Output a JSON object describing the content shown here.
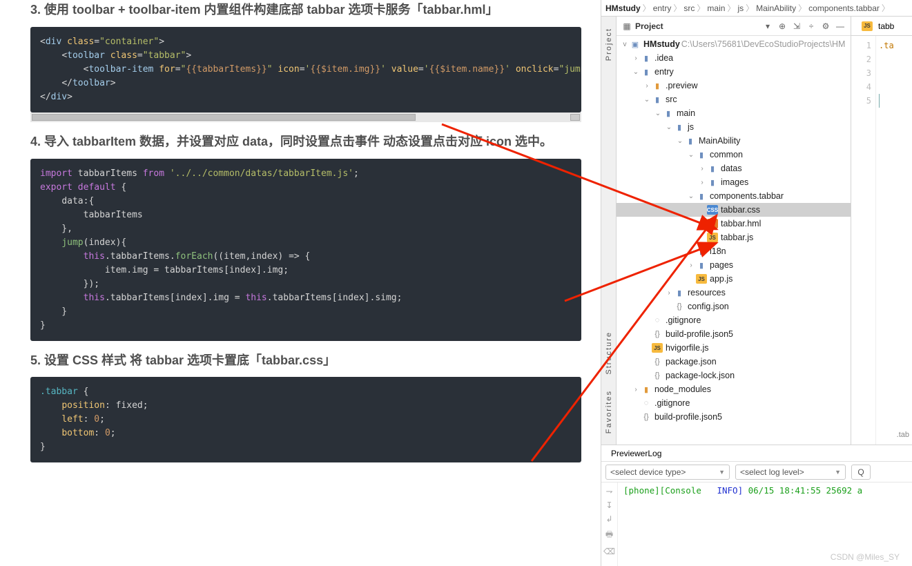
{
  "article": {
    "h3_a": "3. 使用 toolbar + toolbar-item 内置组件构建底部 tabbar 选项卡服务「tabbar.hml」",
    "code1": "<div class=\"container\">\n    <toolbar class=\"tabbar\">\n        <toolbar-item for=\"{{tabbarItems}}\" icon='{{$item.img}}' value='{{$item.name}}' onclick=\"jump($i\n    </toolbar>\n</div>",
    "h3_b": "4. 导入 tabbarItem 数据，并设置对应 data，同时设置点击事件 动态设置点击对应 icon 选中。",
    "code2": "import tabbarItems from '../../common/datas/tabbarItem.js';\nexport default {\n    data:{\n        tabbarItems\n    },\n    jump(index){\n        this.tabbarItems.forEach((item,index) => {\n            item.img = tabbarItems[index].img;\n        });\n        this.tabbarItems[index].img = this.tabbarItems[index].simg;\n    }\n}",
    "h3_c": "5. 设置 CSS 样式 将 tabbar 选项卡置底「tabbar.css」",
    "code3": ".tabbar {\n    position: fixed;\n    left: 0;\n    bottom: 0;\n}"
  },
  "breadcrumb": [
    "HMstudy",
    "entry",
    "src",
    "main",
    "js",
    "MainAbility",
    "components.tabbar"
  ],
  "project": {
    "title": "Project",
    "root": {
      "name": "HMstudy",
      "path": "C:\\Users\\75681\\DevEcoStudioProjects\\HM"
    },
    "tree": [
      {
        "d": 1,
        "caret": ">",
        "icon": "folder",
        "name": ".idea"
      },
      {
        "d": 1,
        "caret": "v",
        "icon": "folder",
        "name": "entry"
      },
      {
        "d": 2,
        "caret": ">",
        "icon": "folder orange",
        "name": ".preview"
      },
      {
        "d": 2,
        "caret": "v",
        "icon": "folder",
        "name": "src"
      },
      {
        "d": 3,
        "caret": "v",
        "icon": "folder",
        "name": "main"
      },
      {
        "d": 4,
        "caret": "v",
        "icon": "folder",
        "name": "js",
        "js": true
      },
      {
        "d": 5,
        "caret": "v",
        "icon": "folder",
        "name": "MainAbility"
      },
      {
        "d": 6,
        "caret": "v",
        "icon": "folder",
        "name": "common"
      },
      {
        "d": 7,
        "caret": ">",
        "icon": "folder",
        "name": "datas"
      },
      {
        "d": 7,
        "caret": ">",
        "icon": "folder",
        "name": "images"
      },
      {
        "d": 6,
        "caret": "v",
        "icon": "folder",
        "name": "components.tabbar"
      },
      {
        "d": 7,
        "caret": " ",
        "icon": "css",
        "name": "tabbar.css",
        "sel": true
      },
      {
        "d": 7,
        "caret": " ",
        "icon": "hml",
        "name": "tabbar.hml"
      },
      {
        "d": 7,
        "caret": " ",
        "icon": "js",
        "name": "tabbar.js"
      },
      {
        "d": 6,
        "caret": ">",
        "icon": "folder",
        "name": "i18n"
      },
      {
        "d": 6,
        "caret": ">",
        "icon": "folder",
        "name": "pages"
      },
      {
        "d": 6,
        "caret": " ",
        "icon": "js",
        "name": "app.js"
      },
      {
        "d": 4,
        "caret": ">",
        "icon": "folder",
        "name": "resources"
      },
      {
        "d": 4,
        "caret": " ",
        "icon": "json",
        "name": "config.json"
      },
      {
        "d": 2,
        "caret": " ",
        "icon": "git",
        "name": ".gitignore"
      },
      {
        "d": 2,
        "caret": " ",
        "icon": "json",
        "name": "build-profile.json5"
      },
      {
        "d": 2,
        "caret": " ",
        "icon": "js",
        "name": "hvigorfile.js"
      },
      {
        "d": 2,
        "caret": " ",
        "icon": "json",
        "name": "package.json"
      },
      {
        "d": 2,
        "caret": " ",
        "icon": "json",
        "name": "package-lock.json"
      },
      {
        "d": 1,
        "caret": ">",
        "icon": "folder orange",
        "name": "node_modules"
      },
      {
        "d": 1,
        "caret": " ",
        "icon": "git",
        "name": ".gitignore"
      },
      {
        "d": 1,
        "caret": " ",
        "icon": "json",
        "name": "build-profile.json5"
      }
    ]
  },
  "editor": {
    "tab": "tabb",
    "lines": [
      "1",
      "2",
      "3",
      "4",
      "5"
    ],
    "content": ".ta",
    "rightStatus": ".tab"
  },
  "previewer": {
    "tab": "PreviewerLog",
    "device_sel": "<select device type>",
    "level_sel": "<select log level>",
    "log_prefix": "[phone][Console",
    "log_level": "INFO]",
    "log_rest": "  06/15 18:41:55 25692  a"
  },
  "sideTabs": {
    "project": "Project",
    "structure": "Structure",
    "favorites": "Favorites"
  },
  "watermark": "CSDN @Miles_SY"
}
